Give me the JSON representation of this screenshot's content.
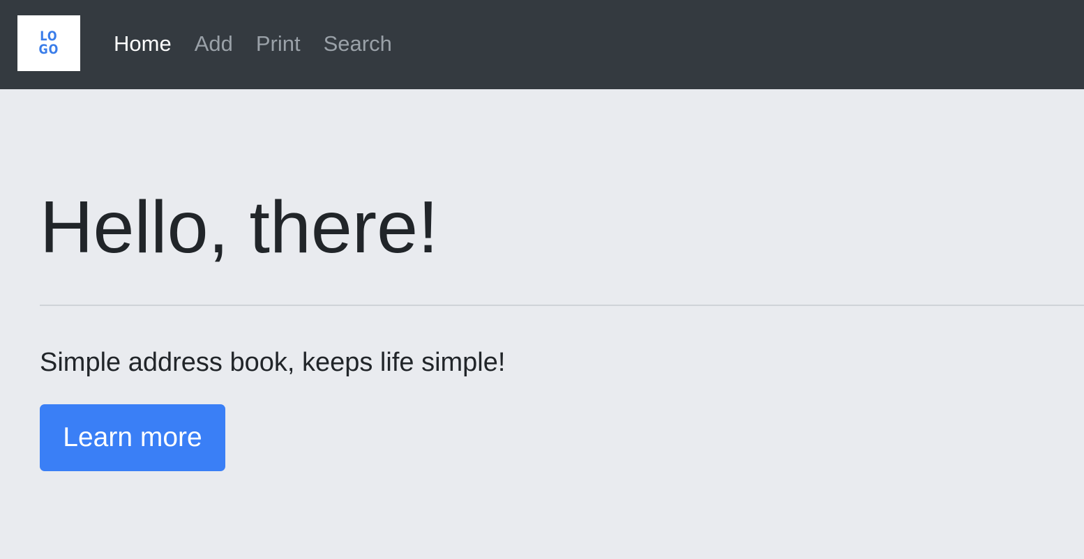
{
  "navbar": {
    "logo_text": [
      "LO",
      "GO"
    ],
    "links": [
      {
        "label": "Home",
        "active": true
      },
      {
        "label": "Add",
        "active": false
      },
      {
        "label": "Print",
        "active": false
      },
      {
        "label": "Search",
        "active": false
      }
    ]
  },
  "hero": {
    "title": "Hello, there!",
    "lead": "Simple address book, keeps life simple!",
    "button_label": "Learn more"
  },
  "colors": {
    "navbar_bg": "#343a40",
    "page_bg": "#e9ebef",
    "primary": "#3a7ff6",
    "logo_text": "#3a7de9",
    "nav_active": "#ffffff",
    "nav_inactive": "#9aa1a8"
  }
}
